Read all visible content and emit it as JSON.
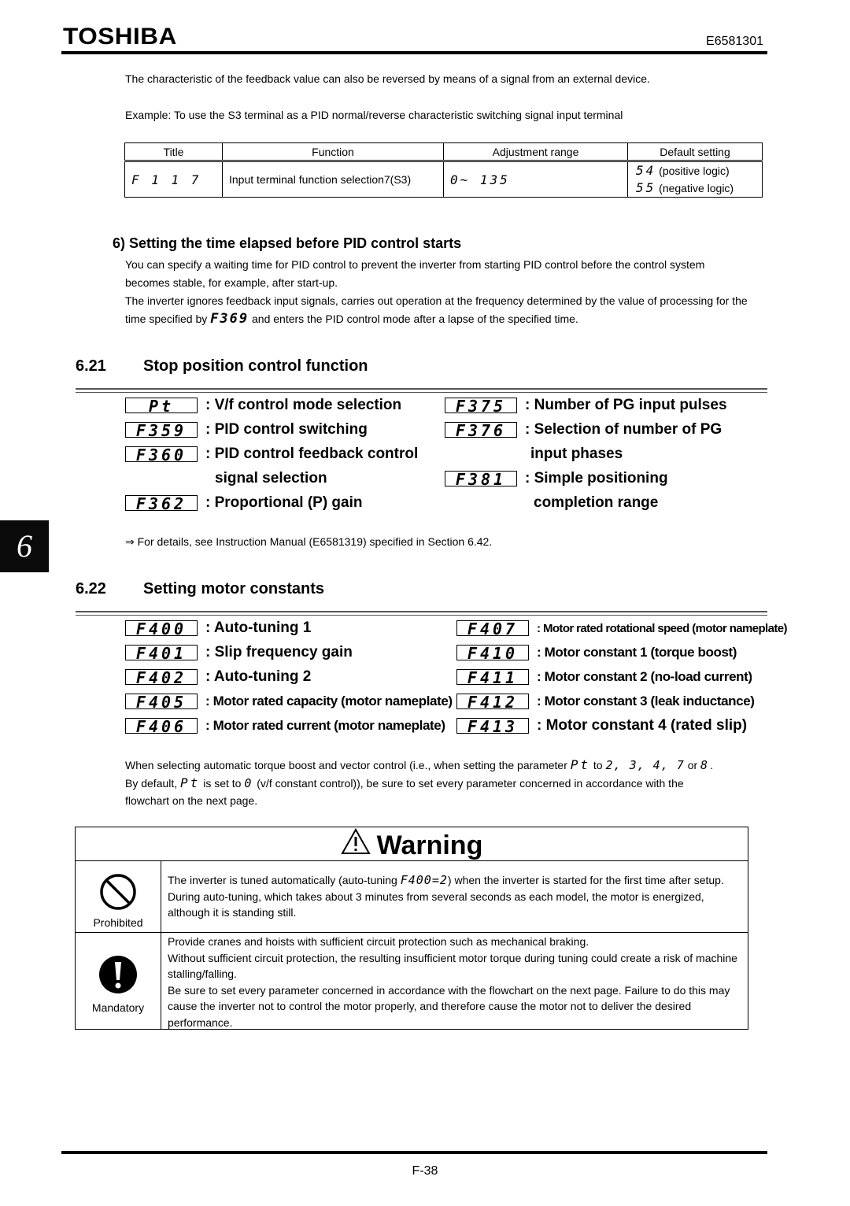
{
  "header": {
    "brand": "TOSHIBA",
    "doc_number": "E6581301"
  },
  "intro": {
    "line1": "The characteristic of the feedback value can also be reversed by means of a signal from an external device.",
    "line2": "Example: To use the S3 terminal as a PID normal/reverse characteristic switching signal input terminal"
  },
  "param_table": {
    "headers": [
      "Title",
      "Function",
      "Adjustment range",
      "Default setting"
    ],
    "rows": [
      {
        "title": "F 1 1 7",
        "function": "Input terminal function selection7(S3)",
        "range": "0~ 135",
        "defaults": [
          {
            "code": "54",
            "note": "(positive logic)"
          },
          {
            "code": "55",
            "note": "(negative logic)"
          }
        ]
      }
    ]
  },
  "subsection6": {
    "title": "6) Setting the time elapsed before PID control starts",
    "para1": "You can specify a waiting time for PID control to prevent the inverter from starting PID control before the control system becomes stable, for example, after start-up.",
    "para2_pre": "The inverter ignores feedback input signals, carries out operation at the frequency determined by the value of processing for the time specified by",
    "para2_code": "F369",
    "para2_post": "and enters the PID control mode after a lapse of the specified time."
  },
  "section_621": {
    "number": "6.21",
    "title": "Stop position control function",
    "left_params": [
      {
        "code": "Pt",
        "desc": ": V/f control mode selection"
      },
      {
        "code": "F359",
        "desc": ": PID control switching"
      },
      {
        "code": "F360",
        "desc": ": PID control feedback control"
      },
      {
        "code": "",
        "desc": "signal selection"
      },
      {
        "code": "F362",
        "desc": ": Proportional (P) gain"
      }
    ],
    "right_params": [
      {
        "code": "F375",
        "desc": ": Number of PG input pulses"
      },
      {
        "code": "F376",
        "desc": ": Selection of number of PG"
      },
      {
        "code": "",
        "desc": "input phases"
      },
      {
        "code": "F381",
        "desc": ": Simple positioning"
      },
      {
        "code": "",
        "desc": "completion range"
      }
    ],
    "reference": "⇒ For details, see Instruction Manual (E6581319) specified in Section 6.42."
  },
  "side_tab": "6",
  "section_622": {
    "number": "6.22",
    "title": "Setting motor constants",
    "left_params": [
      {
        "code": "F400",
        "desc": ": Auto-tuning 1",
        "narrow": false
      },
      {
        "code": "F401",
        "desc": ": Slip frequency gain",
        "narrow": false
      },
      {
        "code": "F402",
        "desc": ": Auto-tuning 2",
        "narrow": false
      },
      {
        "code": "F405",
        "desc": ": Motor rated capacity (motor nameplate)",
        "narrow": true
      },
      {
        "code": "F406",
        "desc": ": Motor rated current (motor nameplate)",
        "narrow": true
      }
    ],
    "right_params": [
      {
        "code": "F407",
        "desc": ": Motor rated rotational speed (motor nameplate)",
        "narrow": true
      },
      {
        "code": "F410",
        "desc": ": Motor constant 1 (torque boost)",
        "narrow": true
      },
      {
        "code": "F411",
        "desc": ": Motor constant 2 (no-load current)",
        "narrow": true
      },
      {
        "code": "F412",
        "desc": ": Motor constant 3 (leak inductance)",
        "narrow": true
      },
      {
        "code": "F413",
        "desc": ": Motor constant 4 (rated slip)",
        "narrow": false
      }
    ],
    "note_line1_pre": "When selecting automatic torque boost and vector control (i.e., when setting the parameter",
    "note_code_pt": "Pt",
    "note_line1_mid": "to",
    "note_values": "2, 3, 4, 7",
    "note_or": "or",
    "note_last_value": "8",
    "note_line2_pre": "By default,",
    "note_line2_mid": "is set to",
    "note_default_value": "0",
    "note_line2_post": "(v/f constant control)), be sure to set every parameter concerned in accordance with the",
    "note_line3": "flowchart on the next page."
  },
  "warning": {
    "title": "Warning",
    "rows": [
      {
        "icon": "prohibited-icon",
        "label": "Prohibited",
        "text_pre": "The inverter is tuned automatically (auto-tuning",
        "text_code": "F400=2",
        "text_post": ") when the inverter is started for the first time after setup. During auto-tuning, which takes about 3 minutes from several seconds as each model, the motor is energized, although it is standing still."
      },
      {
        "icon": "mandatory-icon",
        "label": "Mandatory",
        "lines": [
          "Provide cranes and hoists with sufficient circuit protection such as mechanical braking.",
          "Without sufficient circuit protection, the resulting insufficient motor torque during tuning could create a risk of machine stalling/falling.",
          "Be sure to set every parameter concerned in accordance with the flowchart on the next page. Failure to do this may cause the inverter not to control the motor properly, and therefore cause the motor not to deliver the desired performance."
        ]
      }
    ]
  },
  "footer": {
    "page_number": "F-38"
  }
}
